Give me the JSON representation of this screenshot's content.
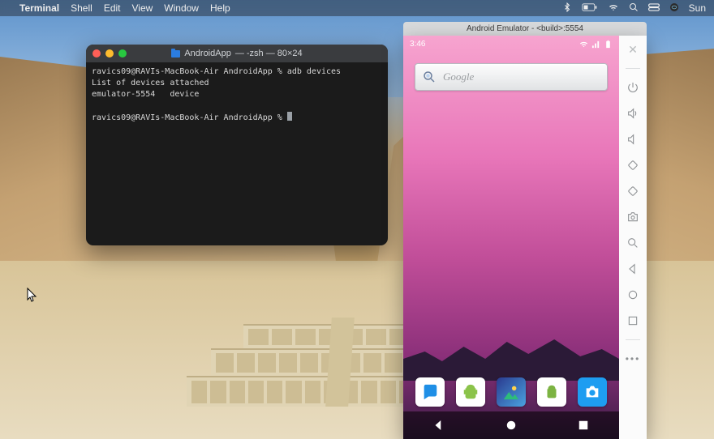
{
  "menubar": {
    "app": "Terminal",
    "items": [
      "Shell",
      "Edit",
      "View",
      "Window",
      "Help"
    ],
    "right_clock": "Sun"
  },
  "terminal": {
    "title_folder": "AndroidApp",
    "title_suffix": "— -zsh — 80×24",
    "lines": [
      "ravics09@RAVIs-MacBook-Air AndroidApp % adb devices",
      "List of devices attached",
      "emulator-5554   device",
      "",
      "ravics09@RAVIs-MacBook-Air AndroidApp % "
    ]
  },
  "emulator": {
    "window_title": "Android Emulator - <build>:5554",
    "status_time": "3:46",
    "search_placeholder": "Google",
    "toolbar_icons": [
      "close-icon",
      "power-icon",
      "volume-up-icon",
      "volume-down-icon",
      "rotate-left-icon",
      "rotate-right-icon",
      "camera-icon",
      "zoom-icon",
      "back-icon",
      "home-icon",
      "overview-icon",
      "more-icon"
    ],
    "dock_apps": [
      "messages",
      "android-sdk",
      "gallery",
      "android",
      "camera"
    ],
    "nav_buttons": [
      "back",
      "home",
      "recents"
    ]
  }
}
